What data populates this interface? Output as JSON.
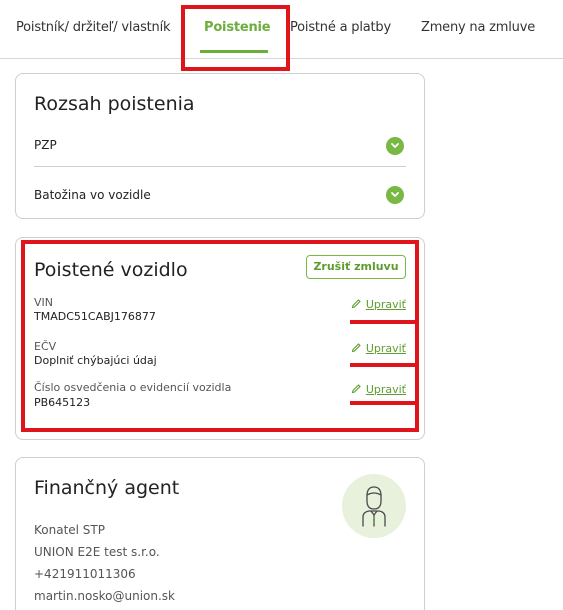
{
  "tabs": [
    {
      "label": "Poistník/ držiteľ/ vlastník"
    },
    {
      "label": "Poistenie"
    },
    {
      "label": "Poistné a platby"
    },
    {
      "label": "Zmeny na zmluve"
    }
  ],
  "coverage": {
    "title": "Rozsah poistenia",
    "items": [
      {
        "label": "PZP"
      },
      {
        "label": "Batožina vo vozidle"
      }
    ]
  },
  "vehicle": {
    "title": "Poistené vozidlo",
    "cancel_label": "Zrušiť zmluvu",
    "fields": [
      {
        "label": "VIN",
        "value": "TMADC51CABJ176877",
        "edit_label": "Upraviť"
      },
      {
        "label": "EČV",
        "value": "Doplniť chýbajúci údaj",
        "edit_label": "Upraviť"
      },
      {
        "label": "Číslo osvedčenia o evidencií vozidla",
        "value": "PB645123",
        "edit_label": "Upraviť"
      }
    ]
  },
  "agent": {
    "title": "Finančný agent",
    "lines": [
      "Konatel STP",
      "UNION E2E test s.r.o.",
      "+421911011306",
      "martin.nosko@union.sk"
    ],
    "icon": "agent-avatar-icon"
  },
  "colors": {
    "accent": "#6cae3b",
    "annotation": "#e0141b"
  }
}
